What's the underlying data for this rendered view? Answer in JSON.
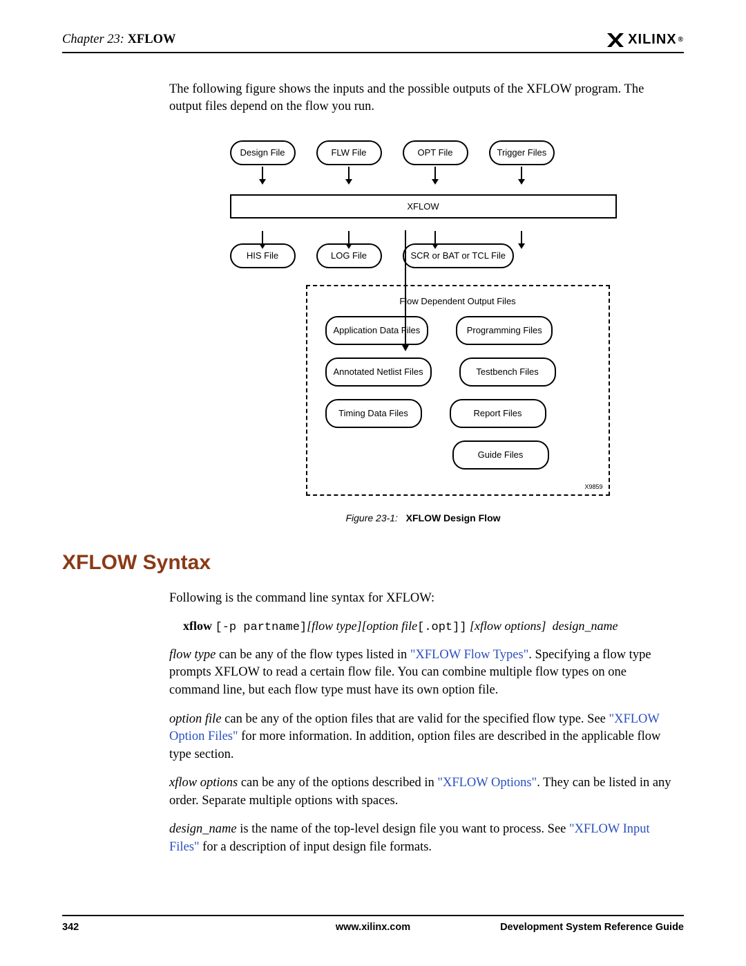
{
  "header": {
    "chapter": "Chapter 23:",
    "title": "XFLOW",
    "brand": "XILINX",
    "reg": "®"
  },
  "intro": "The following figure shows the inputs and the possible outputs of the XFLOW program. The output files depend on the flow you run.",
  "diagram": {
    "top": [
      "Design File",
      "FLW File",
      "OPT File",
      "Trigger Files"
    ],
    "xflow": "XFLOW",
    "row2": [
      "HIS File",
      "LOG File",
      "SCR or BAT or TCL File"
    ],
    "dtitle": "Flow Dependent Output Files",
    "dgrid": [
      [
        "Application Data Files",
        "Programming Files"
      ],
      [
        "Annotated Netlist Files",
        "Testbench Files"
      ],
      [
        "Timing Data Files",
        "Report Files"
      ]
    ],
    "dlast": "Guide Files",
    "figid": "X9859"
  },
  "figcap": {
    "num": "Figure 23-1:",
    "title": "XFLOW Design Flow"
  },
  "h2": "XFLOW Syntax",
  "p1": "Following is the command line syntax for XFLOW:",
  "syntax": {
    "cmd": "xflow",
    "parts": "[-p partname]",
    "flowtype": "[flow type]",
    "optfile": "[option file",
    "opt": "[.opt]]",
    "xfopt": "[xflow options]",
    "dn": "design_name"
  },
  "p2a": "flow type",
  "p2b": " can be any of the flow types listed in ",
  "p2link": "\"XFLOW Flow Types\"",
  "p2c": ". Specifying a flow type prompts XFLOW to read a certain flow file. You can combine multiple flow types on one command line, but each flow type must have its own option file.",
  "p3a": "option file",
  "p3b": " can be any of the option files that are valid for the specified flow type. See ",
  "p3link": "\"XFLOW Option Files\"",
  "p3c": " for more information. In addition, option files are described in the applicable flow type section.",
  "p4a": "xflow options",
  "p4b": " can be any of the options described in ",
  "p4link": "\"XFLOW Options\"",
  "p4c": ". They can be listed in any order. Separate multiple options with spaces.",
  "p5a": "design_name",
  "p5b": " is the name of the top-level design file you want to process. See ",
  "p5link": "\"XFLOW Input Files\"",
  "p5c": " for a description of input design file formats.",
  "footer": {
    "page": "342",
    "url": "www.xilinx.com",
    "guide": "Development System Reference Guide"
  }
}
